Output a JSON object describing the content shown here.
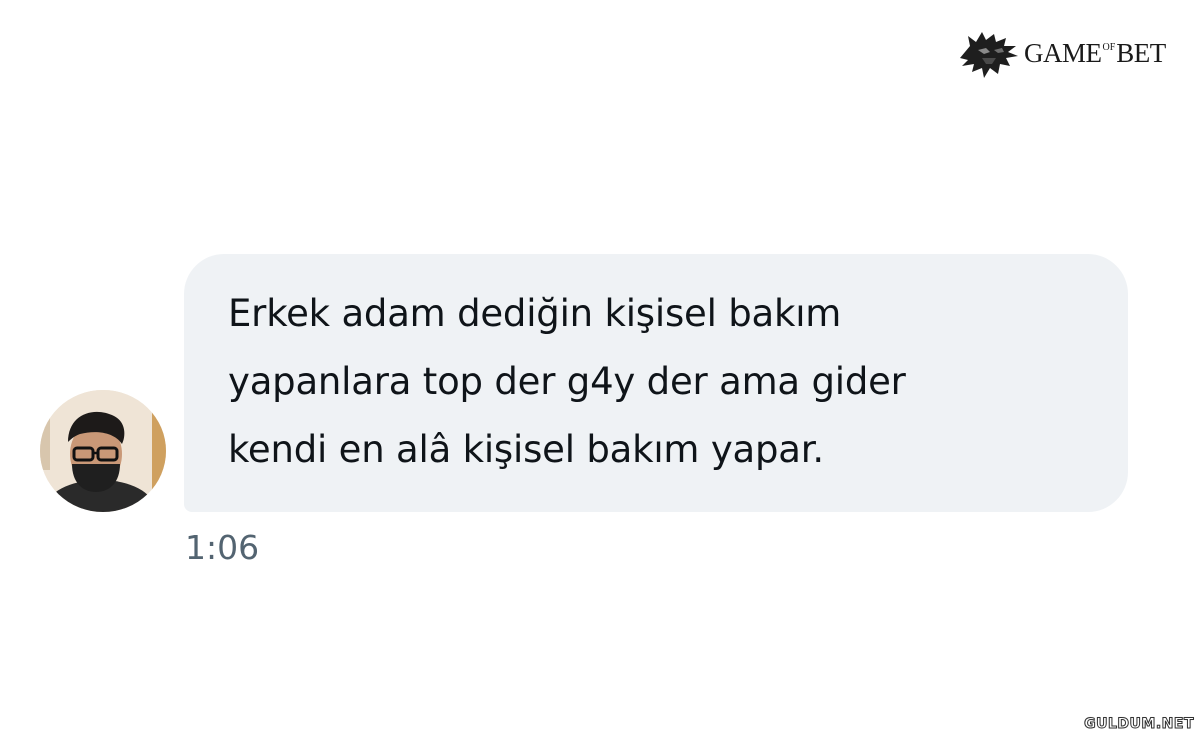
{
  "watermark": {
    "brand": "GAME",
    "brand_of": "OF",
    "brand_end": "BET",
    "bottom": "GULDUM.NET"
  },
  "message": {
    "lines": [
      "Erkek adam dediğin kişisel bakım",
      "yapanlara top der g4y der ama gider",
      "kendi en alâ kişisel bakım yapar."
    ],
    "time": "1:06"
  },
  "colors": {
    "bubble": "#eff2f5",
    "text": "#0f1419",
    "timestamp": "#536471"
  }
}
